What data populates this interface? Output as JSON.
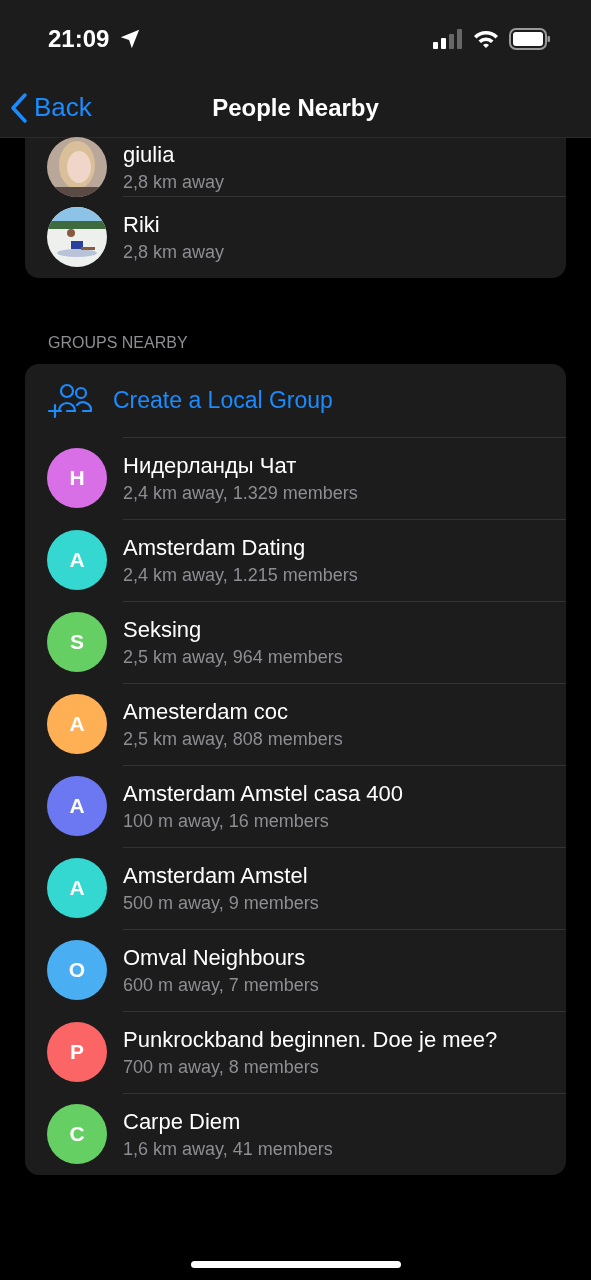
{
  "status_bar": {
    "time": "21:09"
  },
  "nav": {
    "back": "Back",
    "title": "People Nearby"
  },
  "people": [
    {
      "name": "giulia",
      "distance": "2,8 km away",
      "kind": "picture"
    },
    {
      "name": "Riki",
      "distance": "2,8 km away",
      "kind": "picture"
    }
  ],
  "groups_section": {
    "header": "GROUPS NEARBY",
    "create": "Create a Local Group",
    "groups": [
      {
        "initial": "H",
        "name": "Нидерланды Чат",
        "info": "2,4 km away, 1.329 members",
        "color": "#d86fe6"
      },
      {
        "initial": "A",
        "name": "Amsterdam Dating",
        "info": "2,4 km away, 1.215 members",
        "color": "#35d8d0"
      },
      {
        "initial": "S",
        "name": "Seksing",
        "info": "2,5 km away, 964 members",
        "color": "#66cf63"
      },
      {
        "initial": "A",
        "name": "Amesterdam coc",
        "info": "2,5 km away, 808 members",
        "color": "#ffb055"
      },
      {
        "initial": "A",
        "name": "Amsterdam Amstel casa 400",
        "info": "100 m away, 16 members",
        "color": "#6b78f2"
      },
      {
        "initial": "A",
        "name": "Amsterdam Amstel",
        "info": "500 m away, 9 members",
        "color": "#35d8d0"
      },
      {
        "initial": "O",
        "name": "Omval Neighbours",
        "info": "600 m away, 7 members",
        "color": "#4aaef2"
      },
      {
        "initial": "P",
        "name": "Punkrockband beginnen. Doe je mee?",
        "info": "700 m away, 8 members",
        "color": "#fb6565"
      },
      {
        "initial": "C",
        "name": "Carpe Diem",
        "info": "1,6 km away, 41 members",
        "color": "#66cf63"
      }
    ]
  }
}
